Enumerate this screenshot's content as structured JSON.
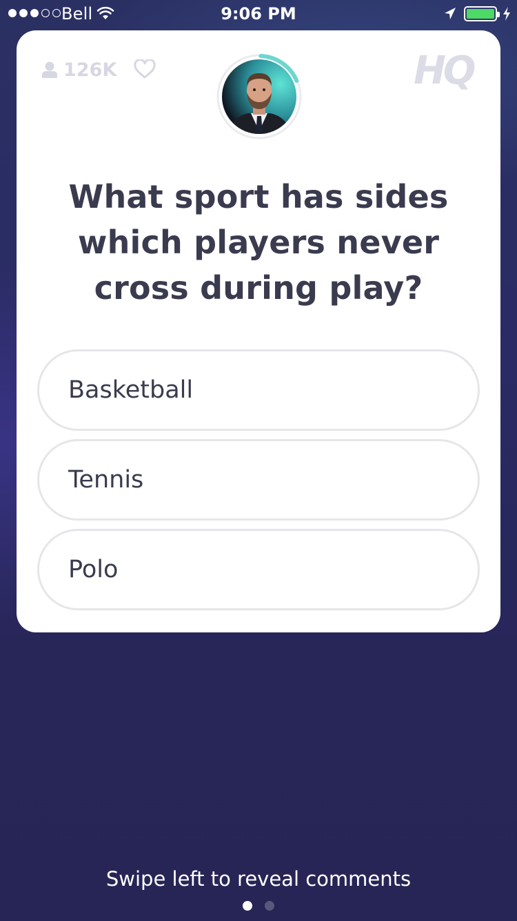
{
  "status_bar": {
    "carrier": "Bell",
    "time": "9:06 PM",
    "signal_bars_filled": 3,
    "signal_bars_total": 5,
    "battery_color": "#4cd964"
  },
  "card": {
    "viewer_count": "126K",
    "logo": "HQ",
    "host_timer_progress": 0.18,
    "timer_color": "#6fd6cf",
    "question": "What sport has sides which players never cross during play?",
    "answers": [
      {
        "label": "Basketball"
      },
      {
        "label": "Tennis"
      },
      {
        "label": "Polo"
      }
    ]
  },
  "footer": {
    "swipe_hint": "Swipe left to reveal comments",
    "page_count": 2,
    "active_page": 1
  },
  "icons": [
    "wifi-icon",
    "location-arrow-icon",
    "battery-icon",
    "charging-bolt-icon",
    "user-icon",
    "heart-icon"
  ]
}
